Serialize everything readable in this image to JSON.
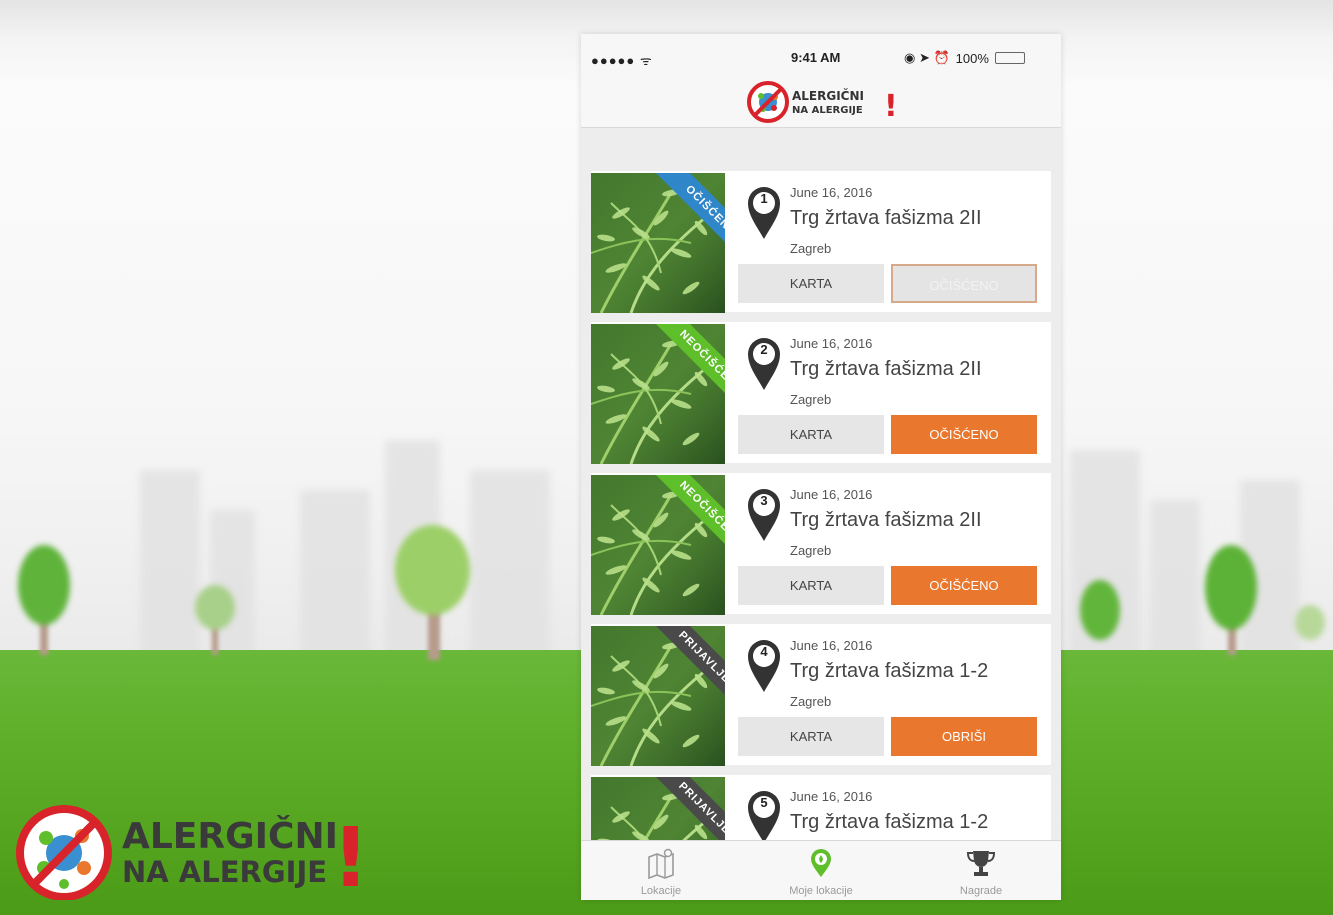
{
  "status_bar": {
    "signal": "●●●●● ᯤ",
    "time": "9:41 AM",
    "icons": "◉ ➤ ⏰",
    "battery": "100%"
  },
  "header": {
    "logo_line1": "ALERGIČNI",
    "logo_line2": "NA ALERGIJE",
    "logo_mark": "!"
  },
  "locations": [
    {
      "number": "1",
      "date": "June 16, 2016",
      "title": "Trg žrtava fašizma 2II",
      "city": "Zagreb",
      "ribbon": "OČIŠĆENO",
      "ribbon_color": "#2f86c9",
      "map_label": "KARTA",
      "action_label": "OČIŠĆENO",
      "action_disabled": true
    },
    {
      "number": "2",
      "date": "June 16, 2016",
      "title": "Trg žrtava fašizma 2II",
      "city": "Zagreb",
      "ribbon": "NEOČIŠĆENO",
      "ribbon_color": "#5fbf2a",
      "map_label": "KARTA",
      "action_label": "OČIŠĆENO",
      "action_disabled": false
    },
    {
      "number": "3",
      "date": "June 16, 2016",
      "title": "Trg žrtava fašizma 2II",
      "city": "Zagreb",
      "ribbon": "NEOČIŠĆENO",
      "ribbon_color": "#5fbf2a",
      "map_label": "KARTA",
      "action_label": "OČIŠĆENO",
      "action_disabled": false
    },
    {
      "number": "4",
      "date": "June 16, 2016",
      "title": "Trg žrtava fašizma 1-2",
      "city": "Zagreb",
      "ribbon": "PRIJAVLJENO",
      "ribbon_color": "#4a4a4a",
      "map_label": "KARTA",
      "action_label": "OBRIŠI",
      "action_disabled": false
    },
    {
      "number": "5",
      "date": "June 16, 2016",
      "title": "Trg žrtava fašizma 1-2",
      "city": "",
      "ribbon": "PRIJAVLJENO",
      "ribbon_color": "#4a4a4a",
      "map_label": "",
      "action_label": "",
      "action_disabled": false
    }
  ],
  "tabs": [
    {
      "label": "Lokacije",
      "icon": "map-icon",
      "active": false
    },
    {
      "label": "Moje lokacije",
      "icon": "location-pin-icon",
      "active": true
    },
    {
      "label": "Nagrade",
      "icon": "trophy-icon",
      "active": false
    }
  ],
  "corner_logo": {
    "line1": "ALERGIČNI",
    "line2": "NA ALERGIJE",
    "mark": "!"
  },
  "colors": {
    "accent_orange": "#e9782e",
    "brand_red": "#d8232a",
    "active_tab_green": "#5fbf2a",
    "grass_green": "#5aa925"
  }
}
